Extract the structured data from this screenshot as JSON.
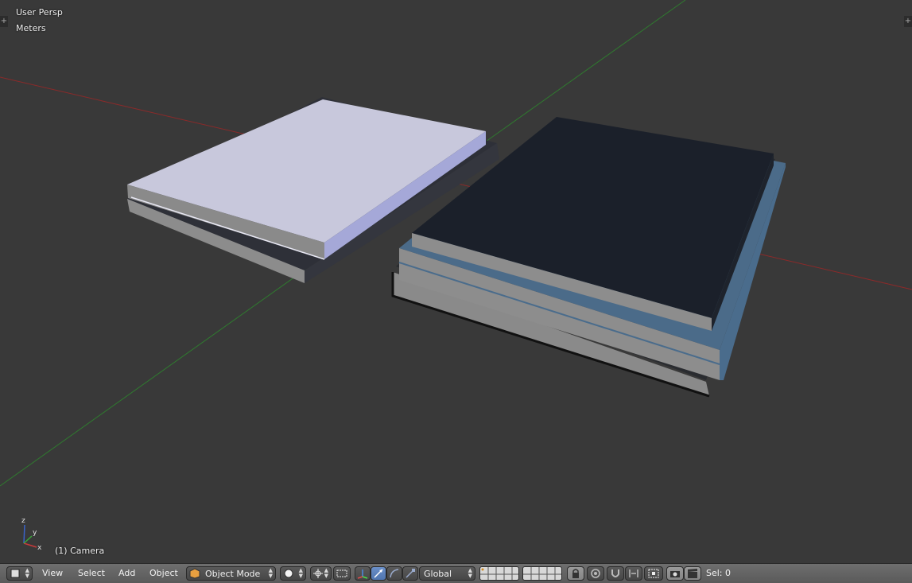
{
  "viewport": {
    "view_name": "User Persp",
    "units": "Meters",
    "active_object": "(1) Camera",
    "axis_labels": {
      "x": "x",
      "y": "y",
      "z": "z"
    }
  },
  "header": {
    "menus": [
      "View",
      "Select",
      "Add",
      "Object"
    ],
    "mode": "Object Mode",
    "transform_orientation": "Global",
    "selection_count": "Sel: 0"
  },
  "colors": {
    "background": "#393939",
    "x_axis": "#8a2a2a",
    "y_axis": "#2f7a2f",
    "light_book_cover": "#c8c8dc",
    "dark_book_cover": "#1b202a",
    "blue_book_edge": "#4a6c8c",
    "active_button": "#5680c2"
  },
  "icons": [
    "editor-type-icon",
    "object-mode-icon",
    "shading-solid-icon",
    "pivot-point-icon",
    "manipulator-toggle-icon",
    "translate-icon",
    "rotate-icon",
    "scale-icon",
    "layers-grid-icon",
    "lock-icon",
    "proportional-edit-icon",
    "snap-icon",
    "snap-element-icon",
    "snap-target-icon",
    "render-icon",
    "clapper-icon"
  ]
}
